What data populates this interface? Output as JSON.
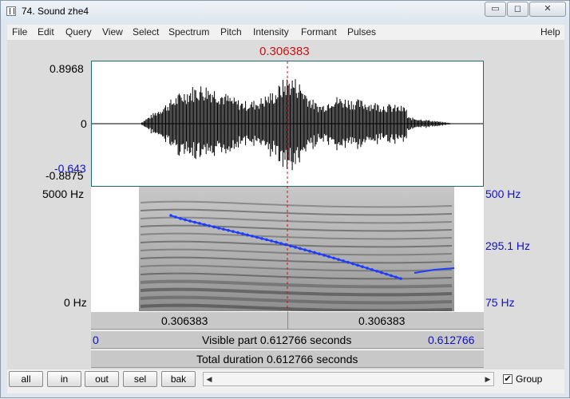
{
  "window": {
    "title": "74. Sound zhe4",
    "minimize": "▭",
    "maximize": "◻",
    "close": "✕"
  },
  "menu": [
    "File",
    "Edit",
    "Query",
    "View",
    "Select",
    "Spectrum",
    "Pitch",
    "Intensity",
    "Formant",
    "Pulses",
    "Help"
  ],
  "cursor_time": "0.306383",
  "waveform": {
    "max": "0.8968",
    "zero": "0",
    "min": "-0.8875",
    "cursor_value": "-0.643"
  },
  "spectrogram": {
    "freq_top": "5000 Hz",
    "freq_bottom": "0 Hz",
    "pitch_top": "500 Hz",
    "pitch_mid": "295.1 Hz",
    "pitch_bottom": "75 Hz"
  },
  "selection_bar": {
    "left": "0.306383",
    "right": "0.306383"
  },
  "visible_bar": {
    "start": "0",
    "text": "Visible part 0.612766 seconds",
    "end": "0.612766"
  },
  "total_bar": {
    "text": "Total duration 0.612766 seconds"
  },
  "buttons": {
    "all": "all",
    "in": "in",
    "out": "out",
    "sel": "sel",
    "bak": "bak"
  },
  "group": {
    "label": "Group",
    "checked": true,
    "check_glyph": "✔"
  },
  "colors": {
    "cursor": "#d01010",
    "pitch": "#1e3cff",
    "axis_blue": "#1010c8"
  }
}
